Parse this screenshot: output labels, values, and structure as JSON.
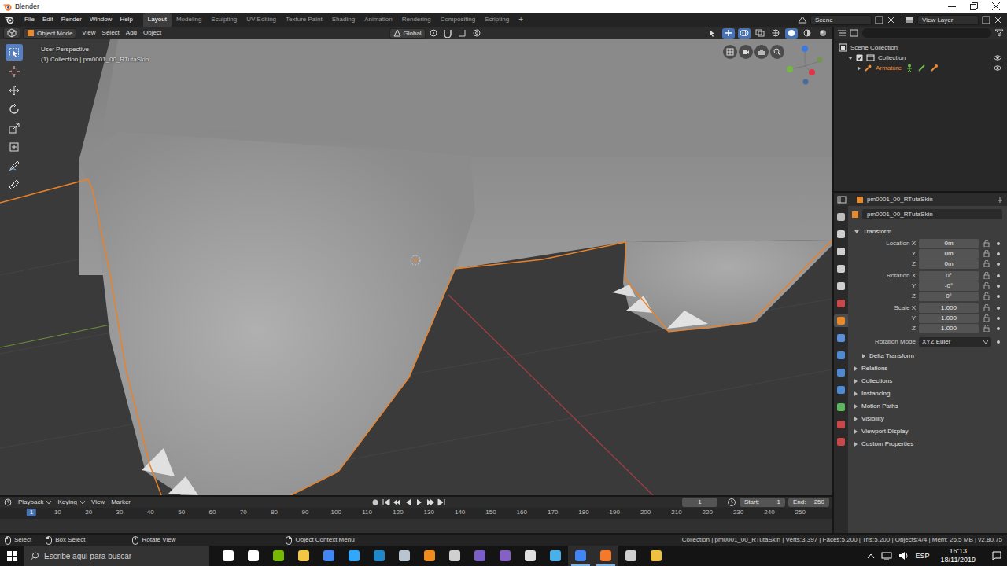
{
  "window": {
    "title": "Blender"
  },
  "topbar": {
    "menus": [
      "File",
      "Edit",
      "Render",
      "Window",
      "Help"
    ],
    "workspaces": [
      {
        "label": "Layout",
        "selected": true
      },
      {
        "label": "Modeling",
        "selected": false
      },
      {
        "label": "Sculpting",
        "selected": false
      },
      {
        "label": "UV Editing",
        "selected": false
      },
      {
        "label": "Texture Paint",
        "selected": false
      },
      {
        "label": "Shading",
        "selected": false
      },
      {
        "label": "Animation",
        "selected": false
      },
      {
        "label": "Rendering",
        "selected": false
      },
      {
        "label": "Compositing",
        "selected": false
      },
      {
        "label": "Scripting",
        "selected": false
      }
    ],
    "add_workspace": "+",
    "scene": "Scene",
    "view_layer": "View Layer"
  },
  "viewport": {
    "mode": "Object Mode",
    "menus": [
      "View",
      "Select",
      "Add",
      "Object"
    ],
    "orientation": "Global",
    "perspective": "User Perspective",
    "info": "(1) Collection | pm0001_00_RTutaSkin",
    "tools": [
      {
        "selected": true
      },
      {
        "selected": false
      },
      {
        "selected": false
      },
      {
        "selected": false
      },
      {
        "selected": false
      },
      {
        "selected": false
      },
      {
        "selected": false
      },
      {
        "selected": false
      }
    ],
    "header_toggles": [
      {
        "on": false
      },
      {
        "on": true
      },
      {
        "on": true
      },
      {
        "on": false
      },
      {
        "on": false
      },
      {
        "on": true
      },
      {
        "on": false
      },
      {
        "on": false
      }
    ]
  },
  "outliner": {
    "tree": [
      {
        "label": "Scene Collection",
        "kind": "scene",
        "children": [
          {
            "label": "Collection",
            "kind": "collection",
            "expanded": true,
            "checked": true,
            "visible": true,
            "children": [
              {
                "label": "Armature",
                "kind": "armature",
                "expanded": false,
                "selected": true,
                "visible": true,
                "children": []
              }
            ]
          }
        ]
      }
    ]
  },
  "properties": {
    "context": "pm0001_00_RTutaSkin",
    "object_name": "pm0001_00_RTutaSkin",
    "tabs": [
      {
        "color": "#bdbdbd",
        "selected": false
      },
      {
        "color": "#cfcfcf",
        "selected": false
      },
      {
        "color": "#cfcfcf",
        "selected": false
      },
      {
        "color": "#cfcfcf",
        "selected": false
      },
      {
        "color": "#cfcfcf",
        "selected": false
      },
      {
        "color": "#c9484b",
        "selected": false
      },
      {
        "color": "#e8892c",
        "selected": true
      },
      {
        "color": "#5b8fd9",
        "selected": false
      },
      {
        "color": "#4f8ad2",
        "selected": false
      },
      {
        "color": "#4f8ad2",
        "selected": false
      },
      {
        "color": "#4f8ad2",
        "selected": false
      },
      {
        "color": "#5fb55f",
        "selected": false
      },
      {
        "color": "#c9484b",
        "selected": false
      },
      {
        "color": "#c9484b",
        "selected": false
      }
    ],
    "transform": {
      "title": "Transform",
      "expanded": true,
      "groups": [
        {
          "rows": [
            {
              "label": "Location X",
              "value": "0m"
            },
            {
              "label": "Y",
              "value": "0m"
            },
            {
              "label": "Z",
              "value": "0m"
            }
          ]
        },
        {
          "rows": [
            {
              "label": "Rotation X",
              "value": "0°"
            },
            {
              "label": "Y",
              "value": "-0°"
            },
            {
              "label": "Z",
              "value": "0°"
            }
          ]
        },
        {
          "rows": [
            {
              "label": "Scale X",
              "value": "1.000"
            },
            {
              "label": "Y",
              "value": "1.000"
            },
            {
              "label": "Z",
              "value": "1.000"
            }
          ]
        }
      ],
      "rotation_mode": {
        "label": "Rotation Mode",
        "value": "XYZ Euler"
      },
      "subpanels": [
        {
          "label": "Delta Transform",
          "expanded": false
        }
      ]
    },
    "panels": [
      {
        "label": "Relations",
        "expanded": false
      },
      {
        "label": "Collections",
        "expanded": false
      },
      {
        "label": "Instancing",
        "expanded": false
      },
      {
        "label": "Motion Paths",
        "expanded": false
      },
      {
        "label": "Visibility",
        "expanded": false
      },
      {
        "label": "Viewport Display",
        "expanded": false
      },
      {
        "label": "Custom Properties",
        "expanded": false
      }
    ]
  },
  "timeline": {
    "menus": [
      {
        "label": "Playback",
        "kind": "dropdown"
      },
      {
        "label": "Keying",
        "kind": "dropdown"
      },
      {
        "label": "View",
        "kind": "menu"
      },
      {
        "label": "Marker",
        "kind": "menu"
      }
    ],
    "frame": "1",
    "start_label": "Start:",
    "start": "1",
    "end_label": "End:",
    "end": "250",
    "current_frame": "1",
    "ticks": [
      "10",
      "20",
      "30",
      "40",
      "50",
      "60",
      "70",
      "80",
      "90",
      "100",
      "110",
      "120",
      "130",
      "140",
      "150",
      "160",
      "170",
      "180",
      "190",
      "200",
      "210",
      "220",
      "230",
      "240",
      "250"
    ]
  },
  "status_bar": {
    "hints": [
      "Select",
      "Box Select",
      "Rotate View",
      "Object Context Menu"
    ],
    "stats": "Collection | pm0001_00_RTutaSkin | Verts:3,397 | Faces:5,200 | Tris:5,200 | Objects:4/4 | Mem: 26.5 MB | v2.80.75"
  },
  "taskbar": {
    "search": "Escribe aquí para buscar",
    "apps": [
      {
        "color": "#ffffff",
        "active": false
      },
      {
        "color": "#ffffff",
        "active": false
      },
      {
        "color": "#76b900",
        "active": false
      },
      {
        "color": "#f2c744",
        "active": false
      },
      {
        "color": "#4285f4",
        "active": false
      },
      {
        "color": "#31a8ff",
        "active": false
      },
      {
        "color": "#1e88c8",
        "active": false
      },
      {
        "color": "#b8c4d0",
        "active": false
      },
      {
        "color": "#f08c1e",
        "active": false
      },
      {
        "color": "#d0d0d0",
        "active": false
      },
      {
        "color": "#7a5fc8",
        "active": false
      },
      {
        "color": "#8661c5",
        "active": false
      },
      {
        "color": "#e0e0e0",
        "active": false
      },
      {
        "color": "#4ab0e8",
        "active": false
      },
      {
        "color": "#4285f4",
        "active": true
      },
      {
        "color": "#f5792a",
        "active": true
      },
      {
        "color": "#d0d0d0",
        "active": false
      },
      {
        "color": "#f0c040",
        "active": false
      }
    ],
    "language": "ESP",
    "time": "16:13",
    "date": "18/11/2019"
  }
}
